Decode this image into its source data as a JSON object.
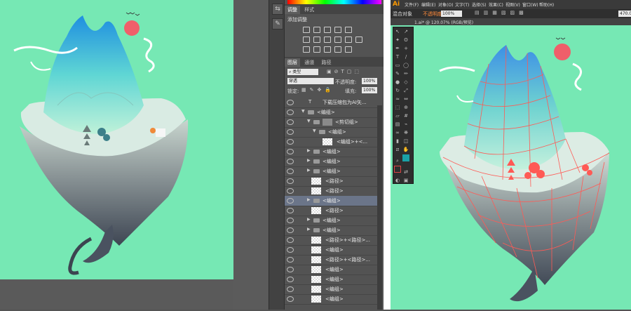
{
  "ps": {
    "panels": {
      "adjust_tabs": [
        "调整",
        "样式"
      ],
      "adjust_title": "添加调整",
      "layer_tabs": [
        "图层",
        "通道",
        "路径"
      ],
      "filter_label": "类型",
      "blend_mode": "穿透",
      "opacity_label": "不透明度:",
      "opacity_value": "100%",
      "lock_label": "锁定:",
      "fill_label": "填充:",
      "fill_value": "100%"
    },
    "layers": [
      {
        "name": "下载压缩包为AI矢...",
        "kind": "text",
        "indent": 0,
        "selected": false
      },
      {
        "name": "<编组>",
        "kind": "group-open",
        "indent": 0,
        "selected": false
      },
      {
        "name": "<剪切组>",
        "kind": "clip-open",
        "indent": 1,
        "selected": false
      },
      {
        "name": "<编组>",
        "kind": "group-open",
        "indent": 2,
        "selected": false
      },
      {
        "name": "<编组>+<...",
        "kind": "item",
        "indent": 3,
        "selected": false
      },
      {
        "name": "<编组>",
        "kind": "group",
        "indent": 1,
        "selected": false
      },
      {
        "name": "<编组>",
        "kind": "group",
        "indent": 1,
        "selected": false
      },
      {
        "name": "<编组>",
        "kind": "group",
        "indent": 1,
        "selected": false
      },
      {
        "name": "<路径>",
        "kind": "item",
        "indent": 1,
        "selected": false
      },
      {
        "name": "<路径>",
        "kind": "item",
        "indent": 1,
        "selected": false
      },
      {
        "name": "<编组>",
        "kind": "group",
        "indent": 1,
        "selected": true
      },
      {
        "name": "<路径>",
        "kind": "item",
        "indent": 1,
        "selected": false
      },
      {
        "name": "<编组>",
        "kind": "group",
        "indent": 1,
        "selected": false
      },
      {
        "name": "<编组>",
        "kind": "group",
        "indent": 1,
        "selected": false
      },
      {
        "name": "<路径>+<路径>...",
        "kind": "item",
        "indent": 1,
        "selected": false
      },
      {
        "name": "<编组>",
        "kind": "item",
        "indent": 1,
        "selected": false
      },
      {
        "name": "<路径>+<路径>...",
        "kind": "item",
        "indent": 1,
        "selected": false
      },
      {
        "name": "<编组>",
        "kind": "item",
        "indent": 1,
        "selected": false
      },
      {
        "name": "<编组>",
        "kind": "item",
        "indent": 1,
        "selected": false
      },
      {
        "name": "<编组>",
        "kind": "item",
        "indent": 1,
        "selected": false
      },
      {
        "name": "<编组>",
        "kind": "item",
        "indent": 1,
        "selected": false
      }
    ]
  },
  "ai": {
    "logo": "Ai",
    "menu": [
      "文件(F)",
      "编辑(E)",
      "对象(O)",
      "文字(T)",
      "选择(S)",
      "效果(C)",
      "视图(V)",
      "窗口(W)",
      "帮助(H)"
    ],
    "ctrl_left": "混合对象",
    "opacity_label": "不透明度",
    "opacity_value": "100%",
    "doc_tab": "1.ai* @ 120.07% (RGB/预览)",
    "coord_value": "470.0"
  },
  "colors": {
    "bg_mint": "#76e8b4",
    "sun": "#ef5f6a",
    "wire": "#ff5a55",
    "selected_layer": "#6b7589"
  }
}
